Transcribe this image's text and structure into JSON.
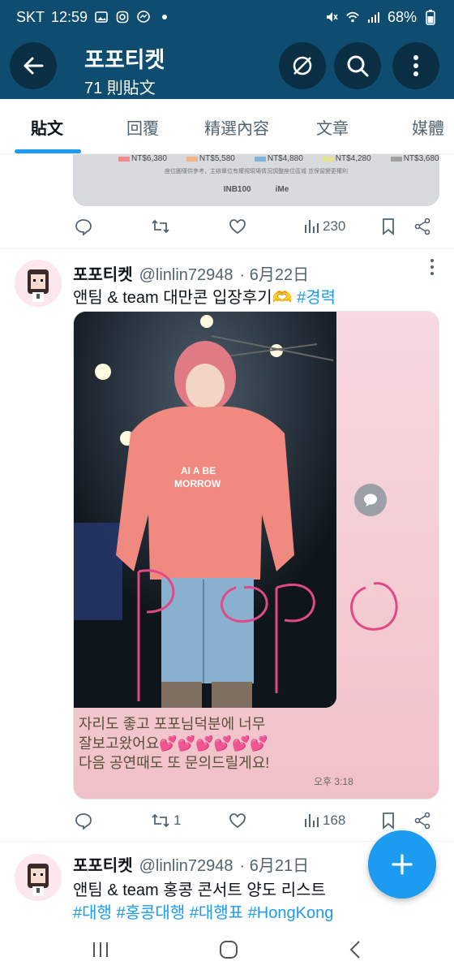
{
  "status": {
    "carrier": "SKT",
    "time": "12:59",
    "battery": "68%"
  },
  "header": {
    "title": "포포티켓",
    "subtitle": "71 則貼文"
  },
  "tabs": [
    {
      "label": "貼文",
      "active": true
    },
    {
      "label": "回覆"
    },
    {
      "label": "精選內容"
    },
    {
      "label": "文章"
    },
    {
      "label": "媒體"
    }
  ],
  "banner": {
    "legend": [
      "NT$6,380",
      "NT$5,580",
      "NT$4,880",
      "NT$4,280",
      "NT$3,680"
    ],
    "legend_colors": [
      "#f28a8a",
      "#f5b38a",
      "#7fb3d9",
      "#e3e38a",
      "#a0a0a0"
    ],
    "note": "座位圖僅供參考，主辦單位有權視現場情況調整座位區域 並保留變更權利",
    "logos": [
      "INB100",
      "iMe"
    ]
  },
  "post1_actions": {
    "views": "230"
  },
  "post2": {
    "name": "포포티켓",
    "handle": "@linlin72948",
    "date": "· 6月22日",
    "text_plain": "앤팀 & team 대만콘 입장후기🫶 ",
    "hashtag": "#경력",
    "caption_lines": [
      "자리도 좋고 포포님덕분에 너무",
      "잘보고왔어요💕💕💕💕💕💕",
      "다음 공연때도 또 문의드릴게요!"
    ],
    "caption_time": "오후 3:18",
    "retweets": "1",
    "views": "168"
  },
  "post3": {
    "name": "포포티켓",
    "handle": "@linlin72948",
    "date": "· 6月21日",
    "text_plain": "앤팀 & team 홍콩 콘서트 양도 리스트",
    "hashtags": [
      "#대행",
      "#홍콩대행",
      "#대행표",
      "#HongKong"
    ]
  },
  "colors": {
    "header_bg": "#0e4d70",
    "accent": "#1d9bf0",
    "muted": "#536471"
  }
}
